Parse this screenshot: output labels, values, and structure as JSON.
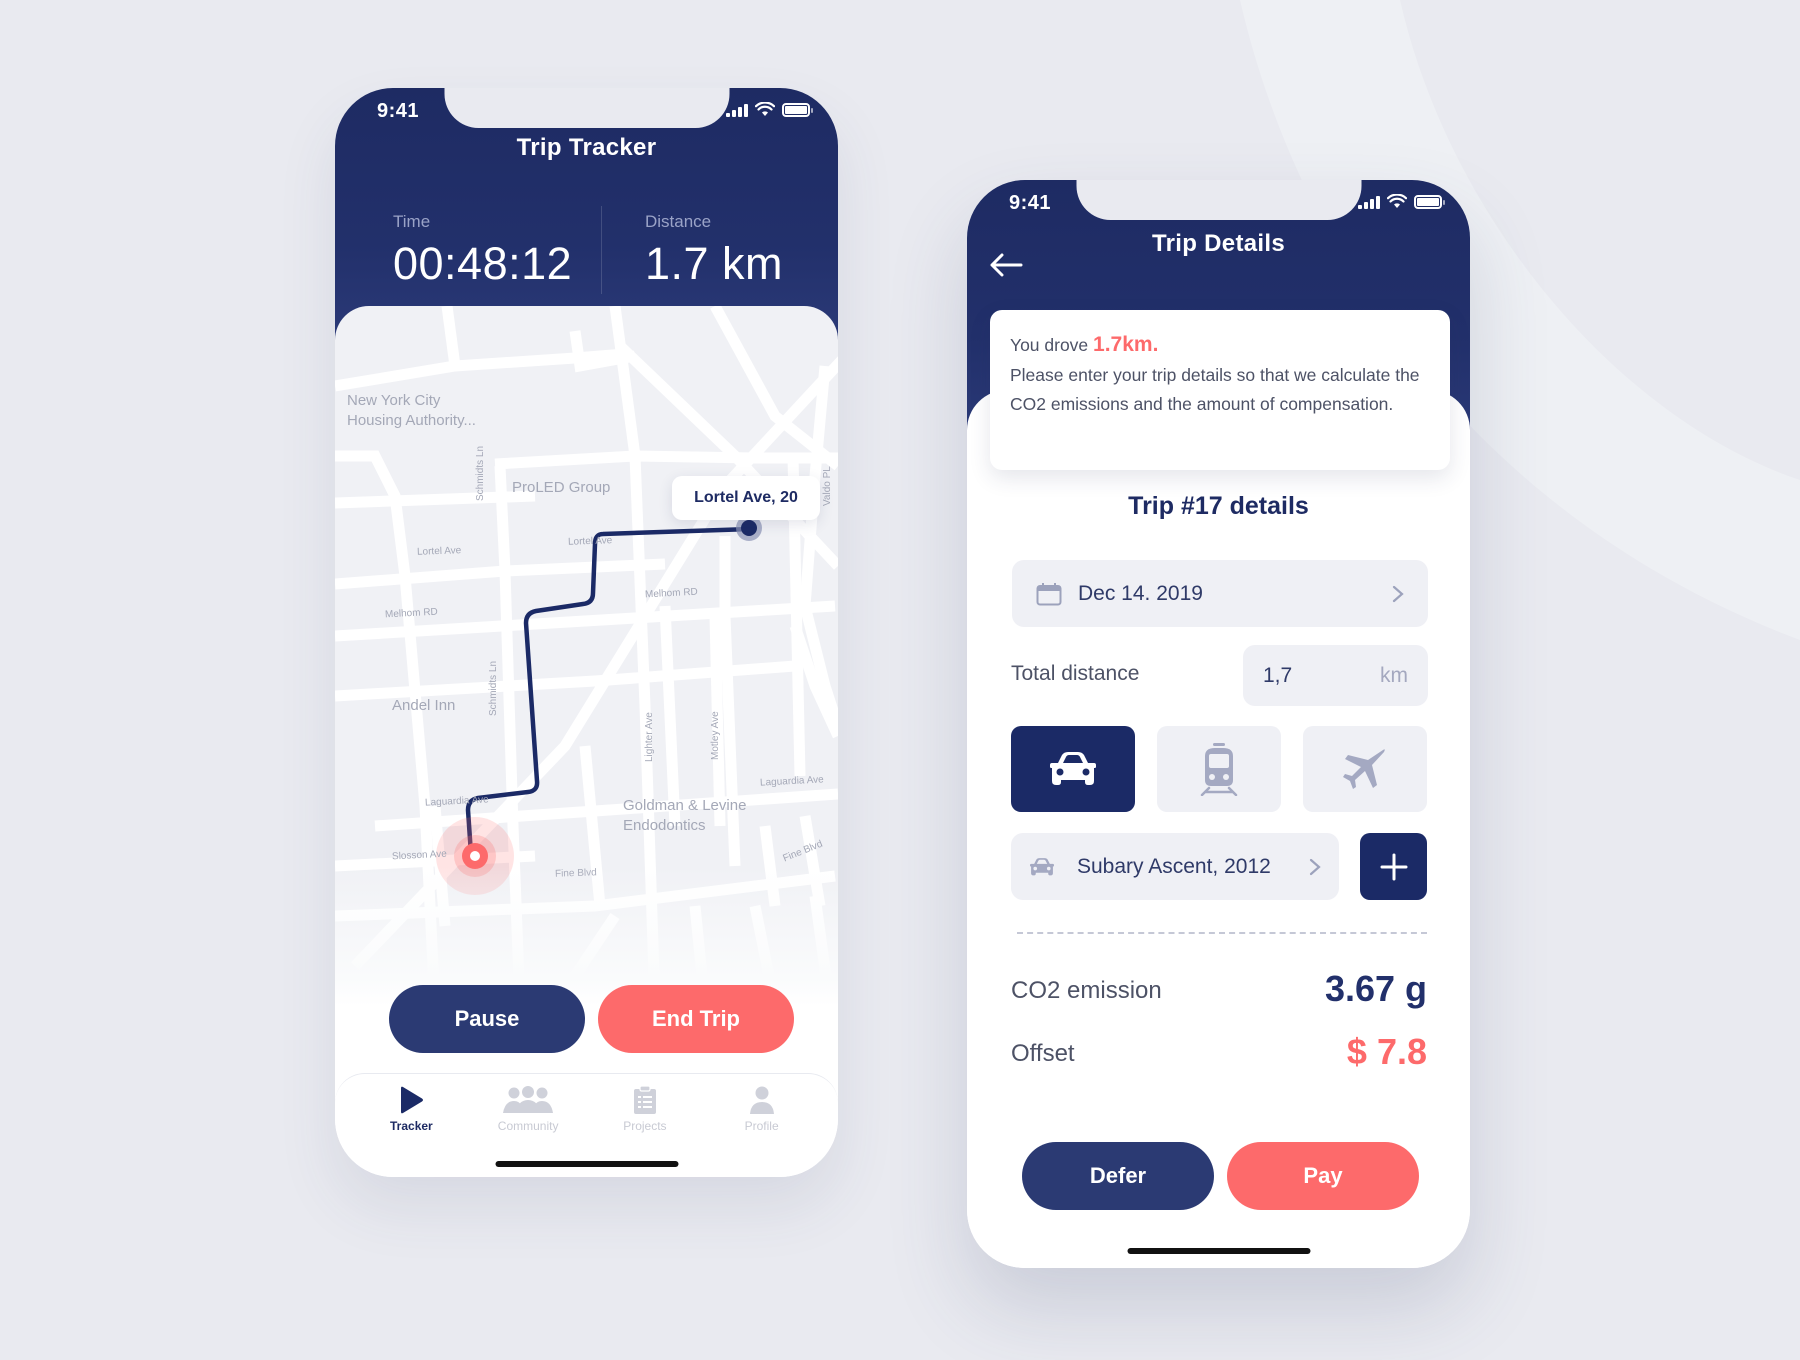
{
  "colors": {
    "navy": "#1e2b63",
    "button_navy": "#2b3a73",
    "coral": "#fd6a6b",
    "background": "#e9eaf0",
    "field_bg": "#eff0f5",
    "muted_text": "#a4a8b7"
  },
  "tracker_screen": {
    "status_bar": {
      "time": "9:41",
      "icons": [
        "signal-icon",
        "wifi-icon",
        "battery-icon"
      ]
    },
    "title": "Trip Tracker",
    "stats": [
      {
        "label": "Time",
        "value": "00:48:12"
      },
      {
        "label": "Distance",
        "value": "1.7 km"
      }
    ],
    "map": {
      "places": [
        {
          "name": "New York City\nHousing Authority..."
        },
        {
          "name": "ProLED Group"
        },
        {
          "name": "Andel Inn"
        },
        {
          "name": "Goldman & Levine\nEndodontics"
        }
      ],
      "streets": [
        "Lortel Ave",
        "Lortel Ave",
        "Melhom RD",
        "Melhom RD",
        "Schmidts Ln",
        "Schmidts Ln",
        "Lighter Ave",
        "Motley Ave",
        "Laguardia Ave",
        "Laguardia Ave",
        "Slosson Ave",
        "Fine Blvd",
        "Fine Blvd",
        "Valdo PL"
      ],
      "destination_callout": "Lortel Ave, 20"
    },
    "buttons": {
      "pause": "Pause",
      "end_trip": "End Trip"
    },
    "tabs": [
      {
        "label": "Tracker",
        "icon": "play-icon",
        "active": true
      },
      {
        "label": "Community",
        "icon": "community-icon",
        "active": false
      },
      {
        "label": "Projects",
        "icon": "clipboard-icon",
        "active": false
      },
      {
        "label": "Profile",
        "icon": "profile-icon",
        "active": false
      }
    ]
  },
  "details_screen": {
    "status_bar": {
      "time": "9:41",
      "icons": [
        "signal-icon",
        "wifi-icon",
        "battery-icon"
      ]
    },
    "title": "Trip Details",
    "back_icon": "arrow-left-icon",
    "info": {
      "prefix": "You drove ",
      "highlight": "1.7km.",
      "message": "Please enter your trip details so that we calculate the CO2 emissions and the amount of compensation."
    },
    "section_title": "Trip #17 details",
    "date_field": {
      "value": "Dec 14. 2019",
      "icon": "calendar-icon"
    },
    "distance": {
      "label": "Total distance",
      "value": "1,7",
      "unit": "km"
    },
    "transport_modes": [
      {
        "name": "car",
        "icon": "car-icon",
        "selected": true
      },
      {
        "name": "train",
        "icon": "train-icon",
        "selected": false
      },
      {
        "name": "plane",
        "icon": "plane-icon",
        "selected": false
      }
    ],
    "vehicle": {
      "value": "Subary Ascent, 2012",
      "icon": "car-icon"
    },
    "add_label": "+",
    "results": [
      {
        "label": "CO2 emission",
        "value": "3.67 g"
      },
      {
        "label": "Offset",
        "value": "$ 7.8"
      }
    ],
    "buttons": {
      "defer": "Defer",
      "pay": "Pay"
    }
  }
}
